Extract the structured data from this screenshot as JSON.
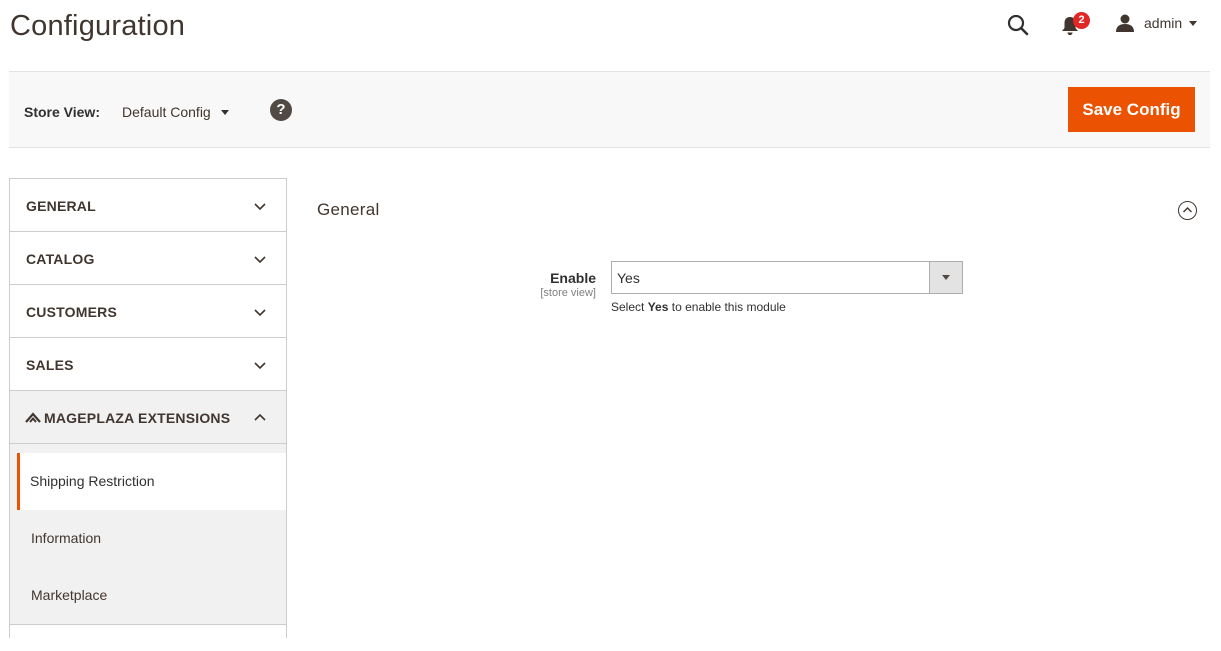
{
  "header": {
    "title": "Configuration",
    "notifications_count": "2",
    "user_name": "admin"
  },
  "toolbar": {
    "store_view_label": "Store View:",
    "store_view_value": "Default Config",
    "help_label": "?",
    "save_label": "Save Config"
  },
  "sidebar": {
    "tabs": [
      {
        "label": "GENERAL"
      },
      {
        "label": "CATALOG"
      },
      {
        "label": "CUSTOMERS"
      },
      {
        "label": "SALES"
      },
      {
        "label": "MAGEPLAZA EXTENSIONS"
      }
    ],
    "subitems": [
      {
        "label": "Shipping Restriction"
      },
      {
        "label": "Information"
      },
      {
        "label": "Marketplace"
      }
    ]
  },
  "section": {
    "title": "General",
    "field": {
      "label": "Enable",
      "scope": "[store view]",
      "value": "Yes",
      "note_prefix": "Select",
      "note_bold": "Yes",
      "note_suffix": "to enable this module"
    }
  },
  "colors": {
    "accent": "#eb5202",
    "badge": "#e22626",
    "text": "#41362f",
    "toolbar_bg": "#f8f8f8",
    "sidebar_open_bg": "#f1f1f1"
  }
}
